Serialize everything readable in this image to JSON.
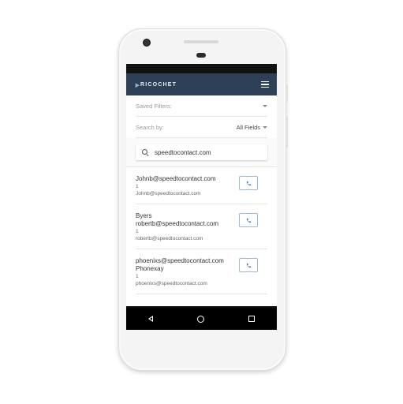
{
  "app": {
    "logo_text": "RICOCHET"
  },
  "filters": {
    "saved_filters_label": "Saved Filters:",
    "search_by_label": "Search by:",
    "search_by_value": "All Fields"
  },
  "search": {
    "value": "speedtocontact.com"
  },
  "contacts": [
    {
      "line1": "Johnb@speedtocontact.com",
      "line2": "1",
      "email": "Johnb@speedtocontact.com"
    },
    {
      "line0": "Byers",
      "line1": "robertb@speedtocontact.com",
      "line2": "1",
      "email": "robertb@speedtocontact.com"
    },
    {
      "line1": "phoenixs@speedtocontact.com",
      "line1b": "Phonexay",
      "line2": "1",
      "email": "phoenixs@speedtocontact.com"
    }
  ],
  "colors": {
    "header": "#2e4057",
    "call_border": "#9db7d4",
    "call_icon": "#3b6ea8"
  }
}
